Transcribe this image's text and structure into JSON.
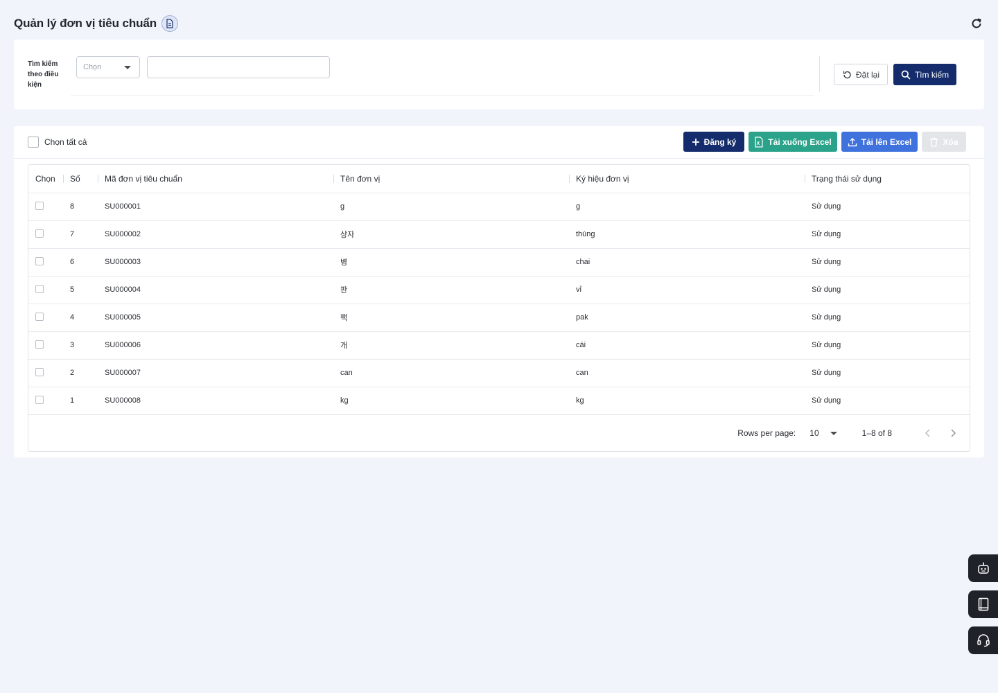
{
  "header": {
    "title": "Quản lý đơn vị tiêu chuẩn",
    "doc_icon": "document-icon",
    "refresh_icon": "refresh-icon"
  },
  "search": {
    "label": "Tìm kiếm theo điều kiện",
    "select_placeholder": "Chọn",
    "input_value": "",
    "reset_label": "Đặt lại",
    "search_label": "Tìm kiếm"
  },
  "toolbar": {
    "select_all_label": "Chọn tất cả",
    "register_label": "Đăng ký",
    "download_label": "Tải xuống Excel",
    "upload_label": "Tải lên Excel",
    "delete_label": "Xóa"
  },
  "table": {
    "columns": [
      "Chọn",
      "Số",
      "Mã đơn vị tiêu chuẩn",
      "Tên đơn vị",
      "Ký hiệu đơn vị",
      "Trạng thái sử dụng"
    ],
    "rows": [
      {
        "no": "8",
        "code": "SU000001",
        "name": "g",
        "symbol": "g",
        "status": "Sử dụng"
      },
      {
        "no": "7",
        "code": "SU000002",
        "name": "상자",
        "symbol": "thùng",
        "status": "Sử dụng"
      },
      {
        "no": "6",
        "code": "SU000003",
        "name": "병",
        "symbol": "chai",
        "status": "Sử dụng"
      },
      {
        "no": "5",
        "code": "SU000004",
        "name": "판",
        "symbol": "vỉ",
        "status": "Sử dụng"
      },
      {
        "no": "4",
        "code": "SU000005",
        "name": "팩",
        "symbol": "pak",
        "status": "Sử dụng"
      },
      {
        "no": "3",
        "code": "SU000006",
        "name": "개",
        "symbol": "cái",
        "status": "Sử dụng"
      },
      {
        "no": "2",
        "code": "SU000007",
        "name": "can",
        "symbol": "can",
        "status": "Sử dụng"
      },
      {
        "no": "1",
        "code": "SU000008",
        "name": "kg",
        "symbol": "kg",
        "status": "Sử dụng"
      }
    ]
  },
  "pagination": {
    "rows_per_page_label": "Rows per page:",
    "rows_per_page": "10",
    "range": "1–8 of 8"
  },
  "colors": {
    "primary": "#142c6b",
    "excel_download": "#2aa38a",
    "excel_upload": "#3f72dc",
    "disabled": "#e3e5e8",
    "background": "#f1f4fa"
  }
}
